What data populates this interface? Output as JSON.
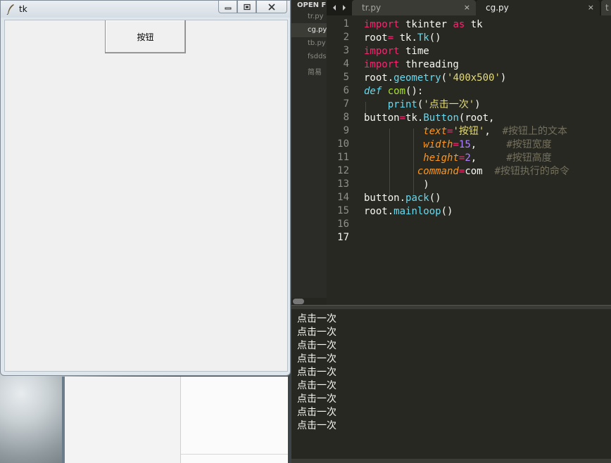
{
  "tk_window": {
    "title": "tk",
    "button_label": "按钮"
  },
  "sidebar": {
    "header": "OPEN FI",
    "files": [
      "tr.py",
      "cg.py",
      "tb.py",
      "fsdds",
      "简易"
    ]
  },
  "tabs": [
    {
      "label": "tr.py",
      "close": "×"
    },
    {
      "label": "cg.py",
      "close": "×"
    },
    {
      "label": "t",
      "close": ""
    }
  ],
  "line_numbers": [
    "1",
    "2",
    "3",
    "4",
    "5",
    "6",
    "7",
    "8",
    "9",
    "10",
    "11",
    "12",
    "13",
    "14",
    "15",
    "16",
    "17"
  ],
  "code": {
    "l1": {
      "kw": "import",
      "a": " tkinter ",
      "kw2": "as",
      "b": " tk"
    },
    "l2": {
      "a": "root",
      "op": "=",
      "b": " tk.",
      "fn": "Tk",
      "c": "()"
    },
    "l3": {
      "kw": "import",
      "a": " time"
    },
    "l4": {
      "kw": "import",
      "a": " threading"
    },
    "l5": {
      "a": "root.",
      "fn": "geometry",
      "b": "(",
      "st": "'400x500'",
      "c": ")"
    },
    "l6": {
      "de": "def",
      "sp": " ",
      "fnname": "com",
      "a": "():"
    },
    "l7": {
      "ind": "    ",
      "fn": "print",
      "a": "(",
      "st": "'点击一次'",
      "b": ")"
    },
    "l8": {
      "a": "button",
      "op": "=",
      "b": "tk.",
      "fn": "Button",
      "c": "(root,"
    },
    "l9": {
      "ind": "          ",
      "pa": "text",
      "op": "=",
      "st": "'按钮'",
      "a": ",  ",
      "cm": "#按钮上的文本"
    },
    "l10": {
      "ind": "          ",
      "pa": "width",
      "op": "=",
      "nu": "15",
      "a": ",     ",
      "cm": "#按钮宽度"
    },
    "l11": {
      "ind": "          ",
      "pa": "height",
      "op": "=",
      "nu": "2",
      "a": ",     ",
      "cm": "#按钮高度"
    },
    "l12": {
      "ind": "         ",
      "pa": "command",
      "op": "=",
      "a": "com  ",
      "cm": "#按钮执行的命令"
    },
    "l13": {
      "ind": "          ",
      "a": ")"
    },
    "l14": {
      "a": "button.",
      "fn": "pack",
      "b": "()"
    },
    "l15": {
      "a": "root.",
      "fn": "mainloop",
      "b": "()"
    }
  },
  "console_output": [
    "点击一次",
    "点击一次",
    "点击一次",
    "点击一次",
    "点击一次",
    "点击一次",
    "点击一次",
    "点击一次",
    "点击一次"
  ],
  "colors": {
    "editor_bg": "#272822",
    "keyword": "#f92672",
    "string": "#e6db74",
    "function": "#66d9ef",
    "param": "#fd971f",
    "number": "#ae81ff",
    "comment": "#75715e"
  }
}
